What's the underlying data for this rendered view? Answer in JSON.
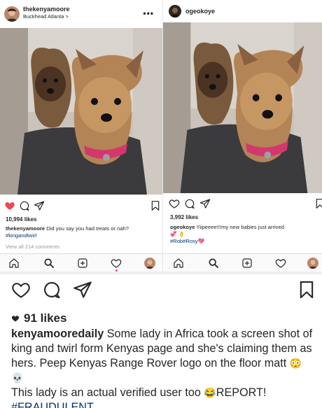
{
  "left_post": {
    "username": "thekenyamoore",
    "location": "Buckhead Atlanta >",
    "likes": "10,994 likes",
    "caption_user": "thekenyamoore",
    "caption_text": " Did you say you had treats or nah?",
    "hashtag": "#kingandtwirl",
    "view_comments": "View all 214 comments"
  },
  "right_post": {
    "username": "ogeokoye",
    "likes": "3,992 likes",
    "caption_user": "ogeokoye",
    "caption_text": " Yiipeeee!!!my new babies just arrived",
    "caption_emoji": "💞 👌",
    "hashtags": "#Rob#Rosy💖"
  },
  "repost": {
    "likes": "91 likes",
    "caption_user": "kenyamooredaily",
    "caption_text": " Some lady in Africa took a screen shot of king and twirl form Kenyas page and she's claiming them as hers. Peep Kenyas Range Rover logo on the floor matt ",
    "emoji_1": "😳💀",
    "caption_text_2": "This lady is an actual verified user too ",
    "emoji_2": "😂",
    "caption_text_3": "REPORT!",
    "hashtag": "#FRAUDULENT"
  },
  "colors": {
    "like_red": "#ed4956",
    "text": "#262626",
    "hashtag": "#003569",
    "muted": "#999999"
  },
  "icons": [
    "heart-icon",
    "comment-icon",
    "share-icon",
    "bookmark-icon",
    "home-icon",
    "search-icon",
    "add-icon",
    "activity-icon",
    "profile-icon",
    "more-icon"
  ]
}
